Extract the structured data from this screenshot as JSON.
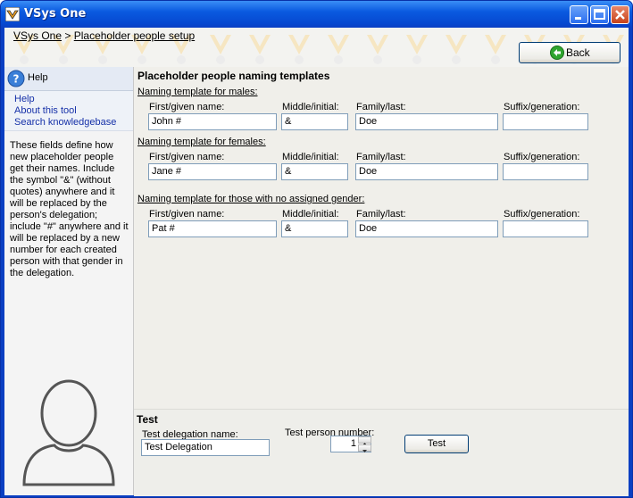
{
  "window": {
    "title": "VSys One"
  },
  "breadcrumb": {
    "home": "VSys One",
    "separator": ">",
    "current": "Placeholder people setup"
  },
  "back_button": {
    "label": "Back"
  },
  "help": {
    "title": "Help",
    "links": [
      "Help",
      "About this tool",
      "Search knowledgebase"
    ],
    "text": "These fields define how new placeholder people get their names. Include the symbol \"&\" (without quotes) anywhere and it will be replaced by the person's delegation; include \"#\" anywhere and it will be replaced by a new number for each created person with that gender in the delegation."
  },
  "main": {
    "title": "Placeholder people naming templates",
    "columns": {
      "first": "First/given name:",
      "middle": "Middle/initial:",
      "family": "Family/last:",
      "suffix": "Suffix/generation:"
    },
    "groups": [
      {
        "label": "Naming template for males:",
        "first": "John #",
        "middle": "&",
        "family": "Doe",
        "suffix": ""
      },
      {
        "label": "Naming template for females:",
        "first": "Jane #",
        "middle": "&",
        "family": "Doe",
        "suffix": ""
      },
      {
        "label": "Naming template for those with no assigned gender:",
        "first": "Pat #",
        "middle": "&",
        "family": "Doe",
        "suffix": ""
      }
    ]
  },
  "test": {
    "title": "Test",
    "delegation_label": "Test delegation name:",
    "delegation_value": "Test Delegation",
    "person_label": "Test person number:",
    "person_value": "1",
    "button": "Test"
  },
  "colors": {
    "titlebar": "#0a5ae0",
    "link": "#1530a8",
    "accent_orange": "#f0a020"
  }
}
